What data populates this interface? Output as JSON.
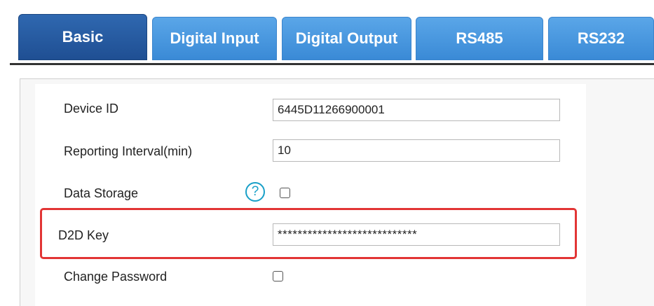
{
  "tabs": [
    {
      "label": "Basic",
      "active": true
    },
    {
      "label": "Digital Input",
      "active": false
    },
    {
      "label": "Digital Output",
      "active": false
    },
    {
      "label": "RS485",
      "active": false
    },
    {
      "label": "RS232",
      "active": false
    }
  ],
  "form": {
    "device_id": {
      "label": "Device ID",
      "value": "6445D11266900001"
    },
    "reporting_interval": {
      "label": "Reporting Interval(min)",
      "value": "10"
    },
    "data_storage": {
      "label": "Data Storage",
      "help_glyph": "?",
      "checked": false
    },
    "d2d_key": {
      "label": "D2D Key",
      "value": "****************************"
    },
    "change_password": {
      "label": "Change Password",
      "checked": false
    }
  },
  "colors": {
    "tab_active": "#1f4f93",
    "tab_inactive": "#3a8ad6",
    "help_icon": "#19a0c8",
    "highlight": "#e23535"
  }
}
